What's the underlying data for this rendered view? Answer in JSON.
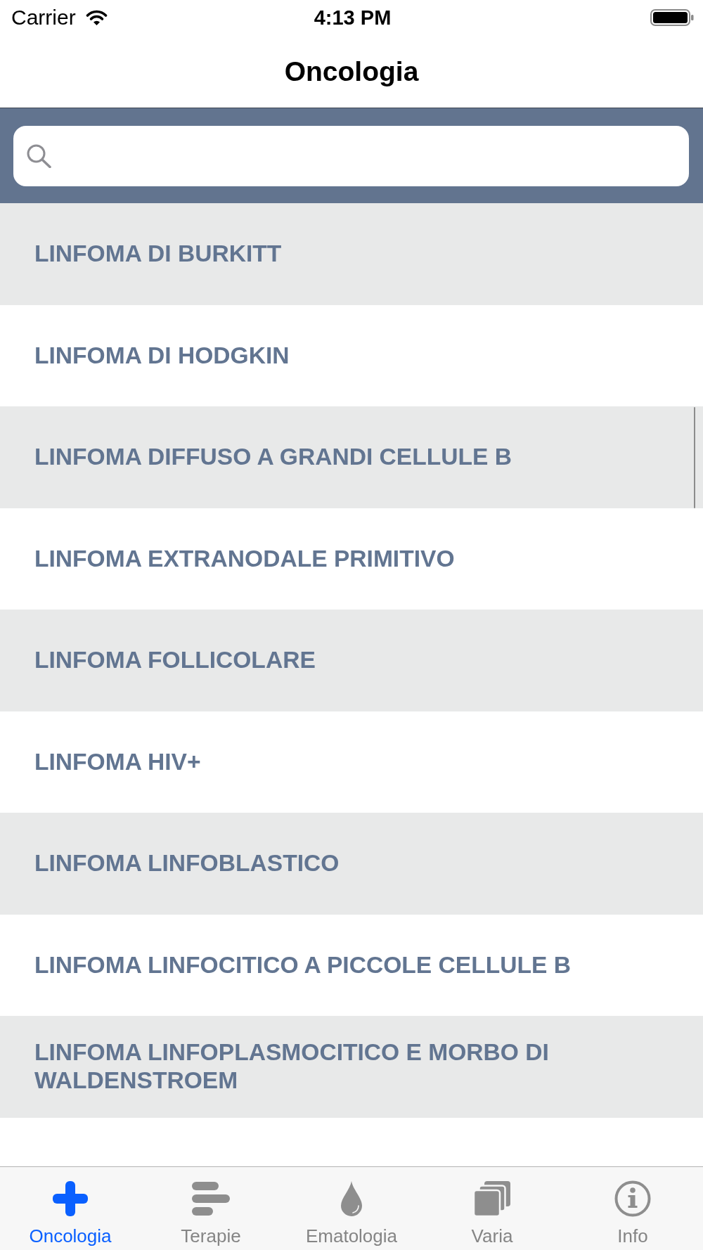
{
  "status_bar": {
    "carrier": "Carrier",
    "time": "4:13 PM"
  },
  "nav_bar": {
    "title": "Oncologia"
  },
  "list": {
    "items": [
      {
        "label": "LINFOMA DI BURKITT"
      },
      {
        "label": "LINFOMA DI HODGKIN"
      },
      {
        "label": "LINFOMA DIFFUSO A GRANDI CELLULE B"
      },
      {
        "label": "LINFOMA EXTRANODALE PRIMITIVO"
      },
      {
        "label": "LINFOMA FOLLICOLARE"
      },
      {
        "label": "LINFOMA HIV+"
      },
      {
        "label": "LINFOMA LINFOBLASTICO"
      },
      {
        "label": "LINFOMA LINFOCITICO A PICCOLE CELLULE B"
      },
      {
        "label": "LINFOMA LINFOPLASMOCITICO E MORBO DI WALDENSTROEM"
      }
    ]
  },
  "tab_bar": {
    "tabs": [
      {
        "label": "Oncologia",
        "selected": true
      },
      {
        "label": "Terapie",
        "selected": false
      },
      {
        "label": "Ematologia",
        "selected": false
      },
      {
        "label": "Varia",
        "selected": false
      },
      {
        "label": "Info",
        "selected": false
      }
    ]
  }
}
